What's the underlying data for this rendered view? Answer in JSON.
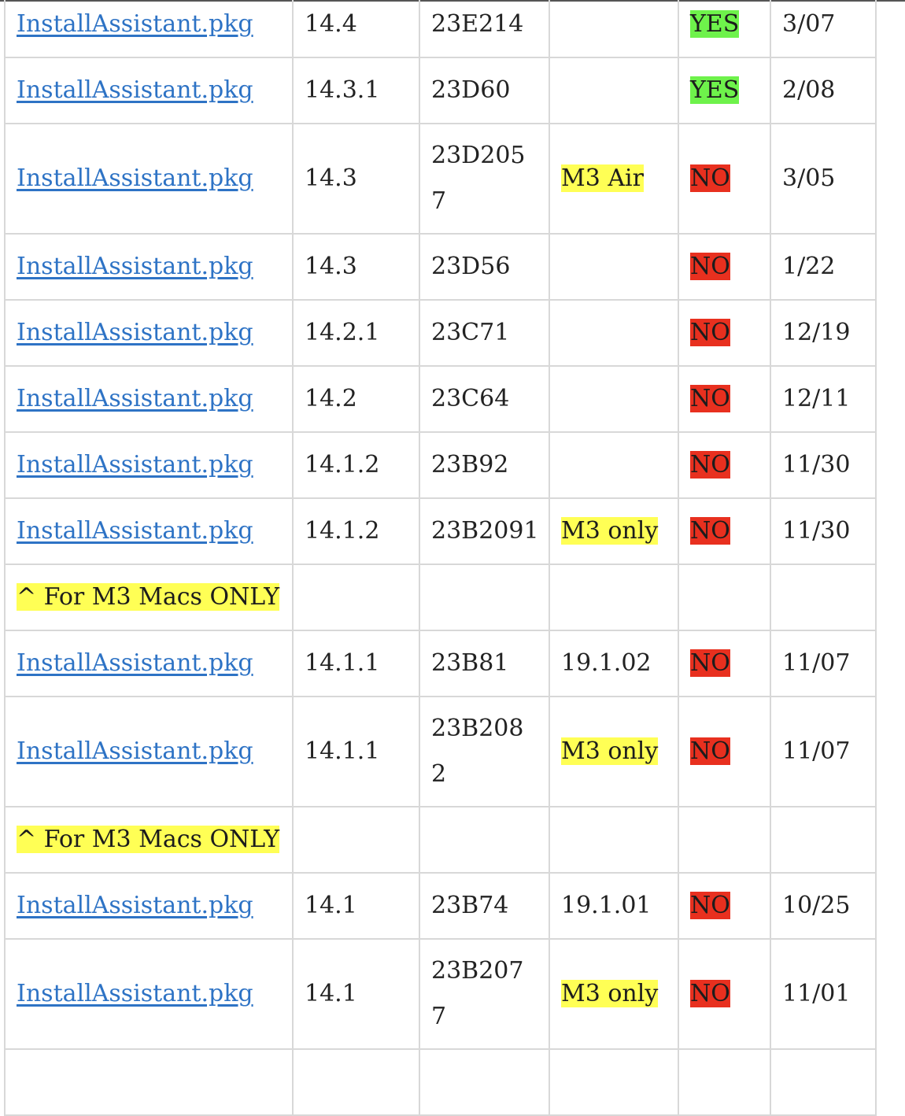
{
  "colors": {
    "link": "#2e73c5",
    "yes_bg": "#6ef24b",
    "no_bg": "#e8301f",
    "note_bg": "#ffff55",
    "border": "#d8d8d8"
  },
  "rows": [
    {
      "file": "InstallAssistant.pkg",
      "version": "14.4",
      "build": [
        "23E214"
      ],
      "note": "",
      "supported": "YES",
      "date": "3/07"
    },
    {
      "file": "InstallAssistant.pkg",
      "version": "14.3.1",
      "build": [
        "23D60"
      ],
      "note": "",
      "supported": "YES",
      "date": "2/08"
    },
    {
      "file": "InstallAssistant.pkg",
      "version": "14.3",
      "build": [
        "23D205",
        "7"
      ],
      "note": "M3 Air",
      "supported": "NO",
      "date": "3/05"
    },
    {
      "file": "InstallAssistant.pkg",
      "version": "14.3",
      "build": [
        "23D56"
      ],
      "note": "",
      "supported": "NO",
      "date": "1/22"
    },
    {
      "file": "InstallAssistant.pkg",
      "version": "14.2.1",
      "build": [
        "23C71"
      ],
      "note": "",
      "supported": "NO",
      "date": "12/19"
    },
    {
      "file": "InstallAssistant.pkg",
      "version": "14.2",
      "build": [
        "23C64"
      ],
      "note": "",
      "supported": "NO",
      "date": "12/11"
    },
    {
      "file": "InstallAssistant.pkg",
      "version": "14.1.2",
      "build": [
        "23B92"
      ],
      "note": "",
      "supported": "NO",
      "date": "11/30"
    },
    {
      "file": "InstallAssistant.pkg",
      "version": "14.1.2",
      "build": [
        "23B2091"
      ],
      "note": "M3 only",
      "supported": "NO",
      "date": "11/30"
    },
    {
      "file": "InstallAssistant.pkg",
      "version": "14.1.1",
      "build": [
        "23B81"
      ],
      "note": "19.1.02",
      "supported": "NO",
      "date": "11/07"
    },
    {
      "file": "InstallAssistant.pkg",
      "version": "14.1.1",
      "build": [
        "23B208",
        "2"
      ],
      "note": "M3 only",
      "supported": "NO",
      "date": "11/07"
    },
    {
      "file": "InstallAssistant.pkg",
      "version": "14.1",
      "build": [
        "23B74"
      ],
      "note": "19.1.01",
      "supported": "NO",
      "date": "10/25"
    },
    {
      "file": "InstallAssistant.pkg",
      "version": "14.1",
      "build": [
        "23B207",
        "7"
      ],
      "note": "M3 only",
      "supported": "NO",
      "date": "11/01"
    }
  ],
  "separators": [
    {
      "text": "^ For M3 Macs ONLY"
    },
    {
      "text": "^ For M3 Macs ONLY"
    }
  ]
}
